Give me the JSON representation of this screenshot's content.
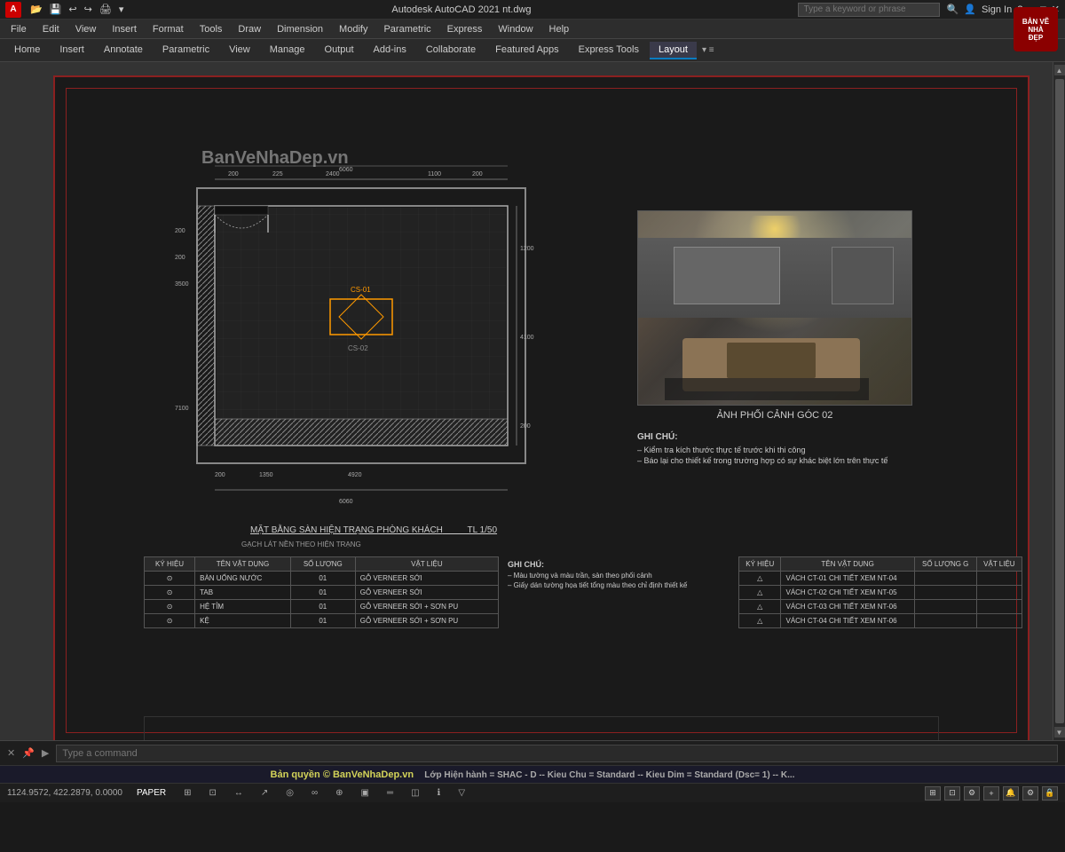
{
  "app": {
    "name": "Autodesk AutoCAD 2021",
    "file": "nt.dwg",
    "title": "Autodesk AutoCAD 2021  nt.dwg"
  },
  "titlebar": {
    "search_placeholder": "Type a keyword or phrase",
    "signin": "Sign In",
    "quick_access": [
      "open-icon",
      "save-icon",
      "undo-icon",
      "redo-icon",
      "plot-icon"
    ]
  },
  "menubar": {
    "items": [
      "File",
      "Edit",
      "View",
      "Insert",
      "Format",
      "Tools",
      "Draw",
      "Dimension",
      "Modify",
      "Parametric",
      "Express",
      "Window",
      "Help"
    ]
  },
  "ribbon": {
    "tabs": [
      "Home",
      "Insert",
      "Annotate",
      "Parametric",
      "View",
      "Manage",
      "Output",
      "Add-ins",
      "Collaborate",
      "Featured Apps",
      "Express Tools",
      "Layout"
    ]
  },
  "drawing": {
    "watermark": "BanVeNhaDep.vn",
    "title": "MẶT BẰNG SÀN HIỆN TRẠNG PHÒNG KHÁCH",
    "scale": "TL 1/50",
    "sub_note": "GẠCH LÁT NỀN THEO HIỆN TRẠNG",
    "photo_caption": "ẢNH PHỐI CẢNH GÓC 02"
  },
  "notes": {
    "title": "GHI CHÚ:",
    "items": [
      "– Kiểm tra kích thước thực tế trước khi thi công",
      "– Báo lại cho thiết kế trong trường hợp có sự khác biệt lớn trên thực tế"
    ]
  },
  "notes_right": {
    "title": "GHI CHÚ:",
    "items": [
      "– Màu tường và màu trần, sàn theo phối cảnh",
      "– Giấy dán tường họa tiết tổng màu theo chỉ định thiết kế"
    ]
  },
  "materials_left": {
    "headers": [
      "KÝ HIỆU",
      "TÊN VẬT DỤNG",
      "SỐ LƯỢNG",
      "VẬT LIỆU"
    ],
    "rows": [
      {
        "symbol": "⊙",
        "name": "BÀN UỐNG NƯỚC",
        "qty": "01",
        "material": "GỖ VERNEER SỚI"
      },
      {
        "symbol": "⊙",
        "name": "TAB",
        "qty": "01",
        "material": "GỖ VERNEER SỚI"
      },
      {
        "symbol": "⊙",
        "name": "HỆ TỈM",
        "qty": "01",
        "material": "GỖ VERNEER SỚI + SƠN PU"
      },
      {
        "symbol": "⊙",
        "name": "KỆ",
        "qty": "01",
        "material": "GỖ VERNEER SỚI + SƠN PU"
      }
    ]
  },
  "materials_right": {
    "headers": [
      "KÝ HIỆU",
      "TÊN VẬT DỤNG",
      "SỐ LƯỢNG",
      "VẬT LIỆU"
    ],
    "rows": [
      {
        "symbol": "△",
        "name": "VÁCH CT-01 CHI TIẾT XEM NT-04",
        "qty": "",
        "material": ""
      },
      {
        "symbol": "△",
        "name": "VÁCH CT-02 CHI TIẾT XEM NT-05",
        "qty": "",
        "material": ""
      },
      {
        "symbol": "△",
        "name": "VÁCH CT-03 CHI TIẾT XEM NT-06",
        "qty": "",
        "material": ""
      },
      {
        "symbol": "△",
        "name": "VÁCH CT-04 CHI TIẾT XEM NT-06",
        "qty": "",
        "material": ""
      }
    ]
  },
  "statusbar": {
    "coordinates": "1124.9572, 422.2879, 0.0000",
    "paper": "PAPER",
    "layer": "Lớp Hiện hành = SHAC - D",
    "kieu_chu": "Kieu Chu = Standard",
    "kieu_dim": "Kieu Dim = Standard (Dsc= 1)",
    "extra": "K..."
  },
  "cmdline": {
    "placeholder": "Type a command"
  },
  "watermark_banner": "Bản quyền © BanVeNhaDep.vn"
}
